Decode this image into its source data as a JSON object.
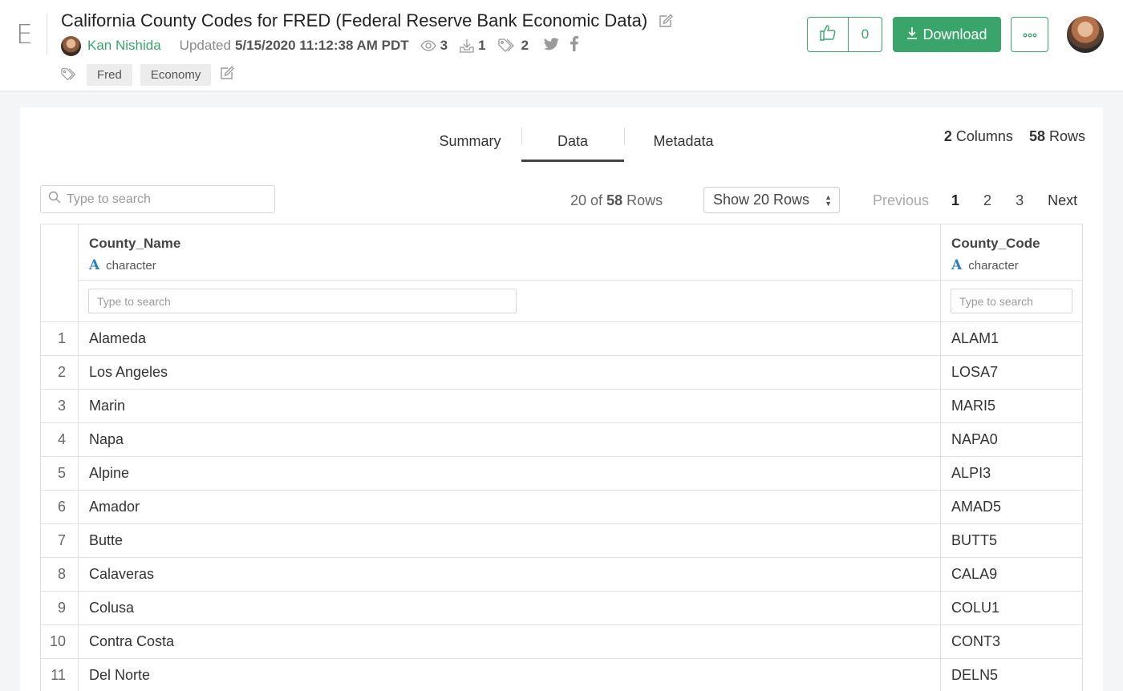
{
  "app": {
    "logo_letter": "E"
  },
  "dataset": {
    "title": "California County Codes for FRED (Federal Reserve Bank Economic Data)",
    "author": "Kan Nishida",
    "updated_label": "Updated",
    "updated_value": "5/15/2020 11:12:38 AM PDT",
    "views": "3",
    "downloads": "1",
    "tag_count": "2",
    "tags": [
      "Fred",
      "Economy"
    ]
  },
  "actions": {
    "like_count": "0",
    "download_label": "Download"
  },
  "tabs": [
    {
      "label": "Summary",
      "active": false
    },
    {
      "label": "Data",
      "active": true
    },
    {
      "label": "Metadata",
      "active": false
    }
  ],
  "summary": {
    "columns_count": "2",
    "columns_label": "Columns",
    "rows_count": "58",
    "rows_label": "Rows"
  },
  "toolbar": {
    "search_placeholder": "Type to search",
    "shown": "20",
    "of_label": "of",
    "total": "58",
    "rows_label": "Rows",
    "show_rows_label": "Show 20 Rows"
  },
  "pagination": {
    "previous": "Previous",
    "pages": [
      "1",
      "2",
      "3"
    ],
    "current": "1",
    "next": "Next"
  },
  "table": {
    "columns": [
      {
        "name": "County_Name",
        "type": "character",
        "filter_placeholder": "Type to search"
      },
      {
        "name": "County_Code",
        "type": "character",
        "filter_placeholder": "Type to search"
      }
    ],
    "rows": [
      [
        "1",
        "Alameda",
        "ALAM1"
      ],
      [
        "2",
        "Los Angeles",
        "LOSA7"
      ],
      [
        "3",
        "Marin",
        "MARI5"
      ],
      [
        "4",
        "Napa",
        "NAPA0"
      ],
      [
        "5",
        "Alpine",
        "ALPI3"
      ],
      [
        "6",
        "Amador",
        "AMAD5"
      ],
      [
        "7",
        "Butte",
        "BUTT5"
      ],
      [
        "8",
        "Calaveras",
        "CALA9"
      ],
      [
        "9",
        "Colusa",
        "COLU1"
      ],
      [
        "10",
        "Contra Costa",
        "CONT3"
      ],
      [
        "11",
        "Del Norte",
        "DELN5"
      ]
    ]
  },
  "colors": {
    "accent": "#3aa56b",
    "type_icon": "#2d7fc3"
  }
}
